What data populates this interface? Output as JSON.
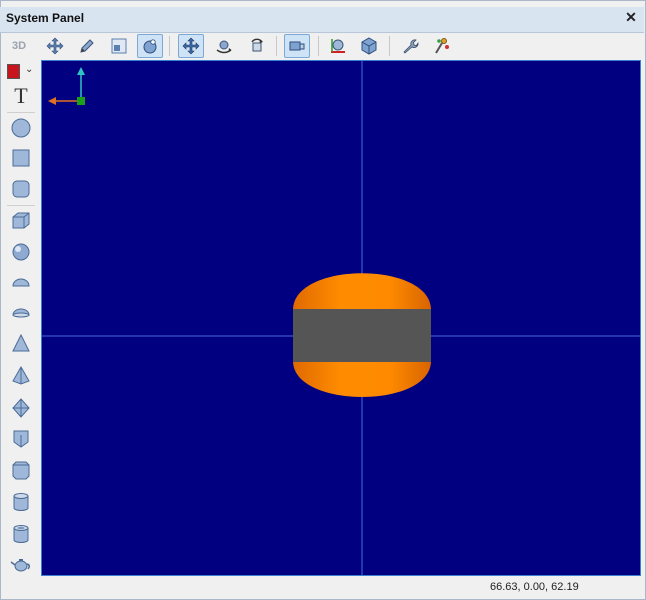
{
  "window": {
    "title": "System Panel",
    "close_glyph": "✕"
  },
  "toolbar": {
    "mode_label": "3D",
    "buttons": [
      {
        "name": "move-icon",
        "active": false
      },
      {
        "name": "pencil-icon",
        "active": false
      },
      {
        "name": "select-region-icon",
        "active": false
      },
      {
        "name": "orbit-target-icon",
        "active": true
      },
      {
        "name": "pan-icon",
        "active": true
      },
      {
        "name": "rotate-icon",
        "active": false
      },
      {
        "name": "rotate-view-icon",
        "active": false
      },
      {
        "name": "camera-box-icon",
        "active": true
      },
      {
        "name": "axes-view-icon",
        "active": false
      },
      {
        "name": "cube-view-icon",
        "active": false
      },
      {
        "name": "wrench-icon",
        "active": false
      },
      {
        "name": "tools-icon",
        "active": false
      }
    ]
  },
  "leftbar": {
    "color": "#c8141c",
    "tools": [
      "text-tool-icon",
      "circle-icon",
      "square-icon",
      "rounded-square-icon",
      "cube-icon",
      "sphere-icon",
      "half-sphere-icon",
      "dome-icon",
      "cone-icon",
      "pyramid-icon",
      "octahedron-icon",
      "prism-icon",
      "hex-prism-icon",
      "cylinder-icon",
      "tube-icon",
      "teapot-icon"
    ]
  },
  "viewport": {
    "background": "#000080",
    "gridline_color": "#4a6ad8",
    "object_top_color": "#ff8a00",
    "object_band_color": "#555555"
  },
  "status": {
    "coordinates": "66.63, 0.00, 62.19"
  }
}
